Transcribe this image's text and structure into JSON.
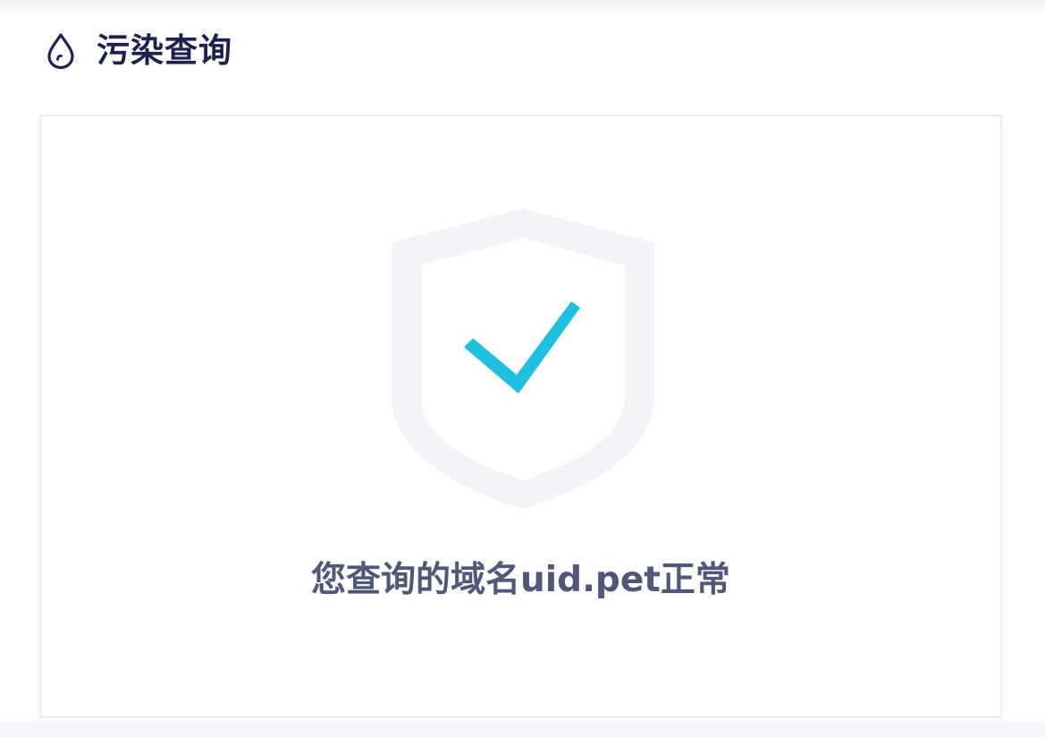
{
  "header": {
    "title": "污染查询",
    "icon": "water-drop-icon"
  },
  "result": {
    "message": "您查询的域名uid.pet正常",
    "status_icon": "shield-check-icon"
  },
  "colors": {
    "title": "#1c2150",
    "message": "#4f5878",
    "check": "#1ec0e2",
    "shield_outer": "#f3f4f8",
    "card_border": "#e8ebf4"
  }
}
